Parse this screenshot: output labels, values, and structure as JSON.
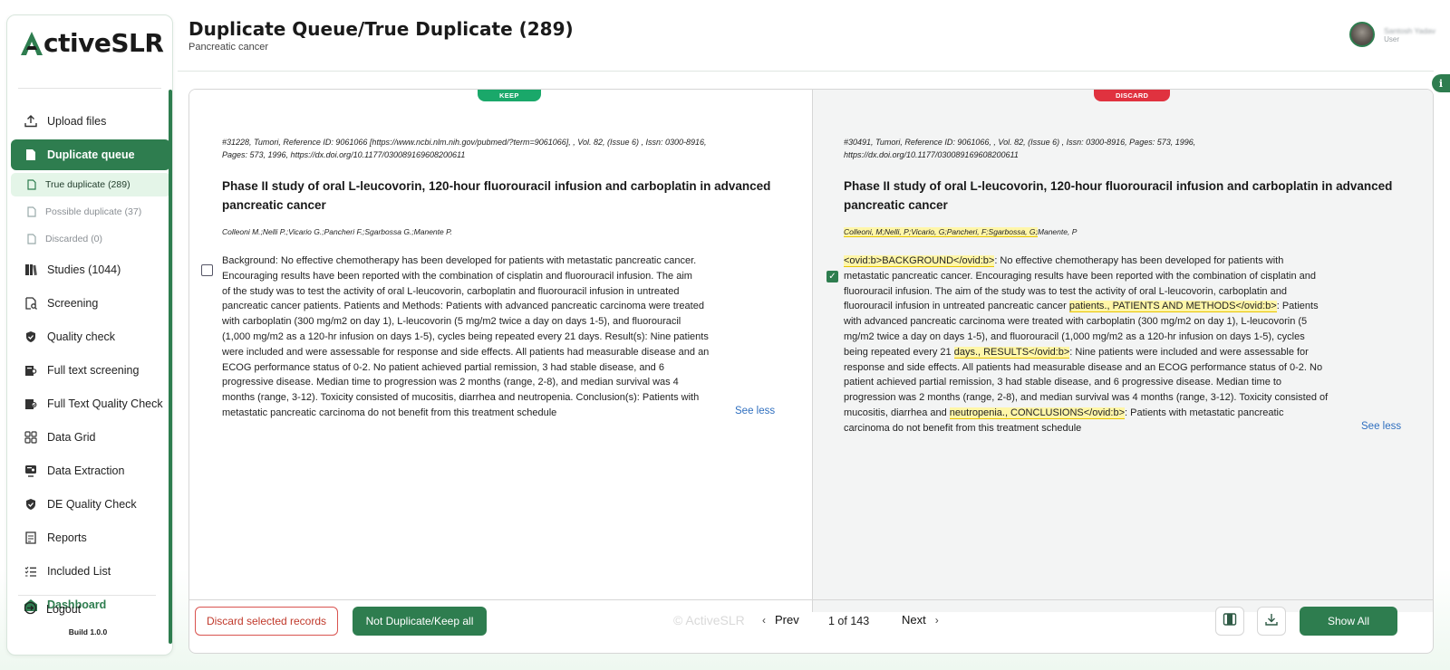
{
  "sidebar": {
    "logo": {
      "mark": "A",
      "text": "ctiveSLR"
    },
    "items": [
      {
        "label": "Upload files",
        "icon": "upload-icon"
      },
      {
        "label": "Duplicate queue",
        "icon": "document-icon"
      },
      {
        "label": "Studies (1044)",
        "icon": "books-icon"
      },
      {
        "label": "Screening",
        "icon": "screening-icon"
      },
      {
        "label": "Quality check",
        "icon": "shield-check-icon"
      },
      {
        "label": "Full text screening",
        "icon": "book-search-icon"
      },
      {
        "label": "Full Text Quality Check",
        "icon": "book-check-icon"
      },
      {
        "label": "Data Grid",
        "icon": "grid-icon"
      },
      {
        "label": "Data Extraction",
        "icon": "extraction-icon"
      },
      {
        "label": "DE Quality Check",
        "icon": "shield-check-icon"
      },
      {
        "label": "Reports",
        "icon": "report-icon"
      },
      {
        "label": "Included List",
        "icon": "checklist-icon"
      },
      {
        "label": "Dashboard",
        "icon": "home-icon"
      }
    ],
    "subitems": [
      {
        "label": "True duplicate (289)"
      },
      {
        "label": "Possible duplicate (37)"
      },
      {
        "label": "Discarded (0)"
      }
    ],
    "logout": "Logout",
    "build": "Build 1.0.0"
  },
  "header": {
    "title": "Duplicate Queue/True Duplicate (289)",
    "subtitle": "Pancreatic cancer",
    "user_name": "Santosh Yadav",
    "user_role": "User",
    "info": "i"
  },
  "left": {
    "tag": "KEEP",
    "ref_line1": "#31228, Tumori,  Reference ID: 9061066 [https://www.ncbi.nlm.nih.gov/pubmed/?term=9061066], , Vol. 82,  (Issue 6) ,  Issn: 0300-8916,",
    "ref_line2": "Pages: 573,  1996,  https://dx.doi.org/10.1177/030089169608200611",
    "title_line1": "Phase II study of oral L-leucovorin, 120-hour fluorouracil infusion and carboplatin in advanced",
    "title_line2": "pancreatic cancer",
    "authors": "Colleoni M.;Nelli P.;Vicario G.;Pancheri F.;Sgarbossa G.;Manente P.",
    "abstract": [
      "Background: No effective chemotherapy has been developed for patients with metastatic pancreatic cancer.",
      "Encouraging results have been reported with the combination of cisplatin and fluorouracil infusion. The aim",
      "of the study was to test the activity of oral L-leucovorin, carboplatin and fluorouracil infusion in untreated",
      "pancreatic cancer patients. Patients and Methods: Patients with advanced pancreatic carcinoma were treated",
      "with carboplatin (300 mg/m2 on day 1), L-leucovorin (5 mg/m2 twice a day on days 1-5), and fluorouracil",
      "(1,000 mg/m2 as a 120-hr infusion on days 1-5), cycles being repeated every 21 days. Result(s): Nine patients",
      "were included and were assessable for response and side effects. All patients had measurable disease and an",
      "ECOG performance status of 0-2. No patient achieved partial remission, 3 had stable disease, and 6",
      "progressive disease. Median time to progression was 2 months (range, 2-8), and median survival was 4",
      "months (range, 3-12). Toxicity consisted of mucositis, diarrhea and neutropenia. Conclusion(s): Patients with",
      "metastatic pancreatic carcinoma do not benefit from this treatment schedule"
    ],
    "see_less": "See less"
  },
  "right": {
    "tag": "DISCARD",
    "ref_line1": "#30491, Tumori,  Reference ID: 9061066, , Vol. 82,  (Issue 6) ,  Issn: 0300-8916,  Pages: 573,  1996,",
    "ref_line2": "https://dx.doi.org/10.1177/030089169608200611",
    "title_line1": "Phase II study of oral L-leucovorin, 120-hour fluorouracil infusion and carboplatin in advanced",
    "title_line2": "pancreatic cancer",
    "authors": [
      "Colleoni, M;",
      "Nelli, P;",
      "Vicario, G;",
      "Pancheri, F;",
      "Sgarbossa, G;",
      "Manente, P"
    ],
    "abstract": {
      "l1_hl": "<ovid:b>BACKGROUND</ovid:b>",
      "l1_rest": ": No effective chemotherapy has been developed for patients with",
      "l2": "metastatic pancreatic cancer. Encouraging results have been reported with the combination of cisplatin and",
      "l3": "fluorouracil infusion. The aim of the study was to test the activity of oral L-leucovorin, carboplatin and",
      "l4_pre": "fluorouracil infusion in untreated pancreatic cancer ",
      "l4_hl": "patients., PATIENTS AND METHODS</ovid:b>",
      "l4_post": ": Patients",
      "l5": "with advanced pancreatic carcinoma were treated with carboplatin (300 mg/m2 on day 1), L-leucovorin (5",
      "l6": "mg/m2 twice a day on days 1-5), and fluorouracil (1,000 mg/m2 as a 120-hr infusion on days 1-5), cycles",
      "l7_pre": "being repeated every 21 ",
      "l7_hl": "days., RESULTS</ovid:b>",
      "l7_post": ": Nine patients were included and were assessable for",
      "l8": "response and side effects. All patients had measurable disease and an ECOG performance status of 0-2. No",
      "l9": "patient achieved partial remission, 3 had stable disease, and 6 progressive disease. Median time to",
      "l10": "progression was 2 months (range, 2-8), and median survival was 4 months (range, 3-12). Toxicity consisted of",
      "l11_pre": "mucositis, diarrhea and ",
      "l11_hl": "neutropenia., CONCLUSIONS</ovid:b>",
      "l11_post": ": Patients with metastatic pancreatic",
      "l12": "carcinoma do not benefit from this treatment schedule"
    },
    "see_less": "See less"
  },
  "footer": {
    "discard_btn": "Discard selected records",
    "keep_btn": "Not Duplicate/Keep all",
    "watermark": "© ActiveSLR",
    "prev": "Prev",
    "page": "1 of 143",
    "next": "Next",
    "show_all": "Show All"
  },
  "colors": {
    "brand": "#2e7d4f",
    "keep": "#1aa86a",
    "discard": "#e0323f",
    "highlight": "#fff6a8"
  }
}
